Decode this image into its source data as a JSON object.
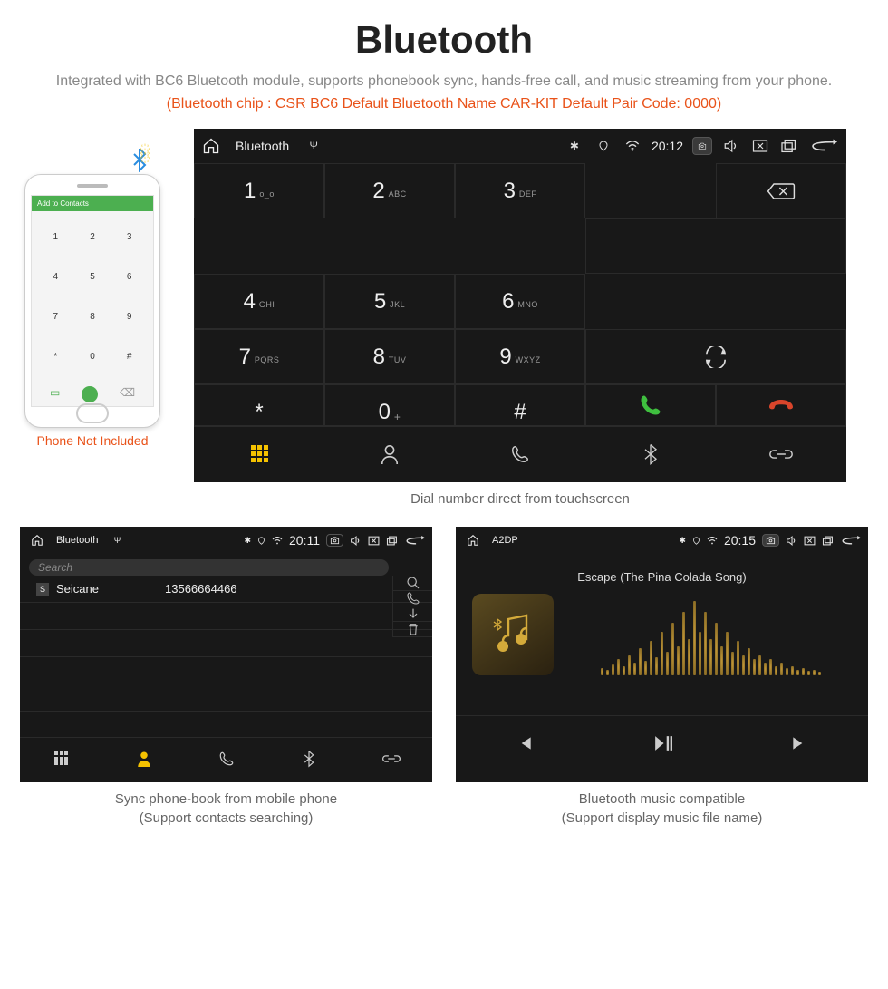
{
  "header": {
    "title": "Bluetooth",
    "subtitle": "Integrated with BC6 Bluetooth module, supports phonebook sync, hands-free call, and music streaming from your phone.",
    "specs": "(Bluetooth chip : CSR BC6    Default Bluetooth Name CAR-KIT    Default Pair Code: 0000)"
  },
  "phone_mock": {
    "top_label": "Add to Contacts",
    "digits": [
      "1",
      "2",
      "3",
      "4",
      "5",
      "6",
      "7",
      "8",
      "9",
      "*",
      "0",
      "#"
    ],
    "note": "Phone Not Included"
  },
  "hu_dialer": {
    "statusbar": {
      "title": "Bluetooth",
      "time": "20:12"
    },
    "keys": [
      {
        "d": "1",
        "s": "o_o"
      },
      {
        "d": "2",
        "s": "ABC"
      },
      {
        "d": "3",
        "s": "DEF"
      },
      {
        "d": "4",
        "s": "GHI"
      },
      {
        "d": "5",
        "s": "JKL"
      },
      {
        "d": "6",
        "s": "MNO"
      },
      {
        "d": "7",
        "s": "PQRS"
      },
      {
        "d": "8",
        "s": "TUV"
      },
      {
        "d": "9",
        "s": "WXYZ"
      },
      {
        "d": "*",
        "s": ""
      },
      {
        "d": "0",
        "s": "+"
      },
      {
        "d": "#",
        "s": ""
      }
    ],
    "caption": "Dial number direct from touchscreen"
  },
  "hu_phonebook": {
    "statusbar": {
      "title": "Bluetooth",
      "time": "20:11"
    },
    "search_placeholder": "Search",
    "rows": [
      {
        "badge": "S",
        "name": "Seicane",
        "number": "13566664466"
      }
    ],
    "caption_line1": "Sync phone-book from mobile phone",
    "caption_line2": "(Support contacts searching)"
  },
  "hu_music": {
    "statusbar": {
      "title": "A2DP",
      "time": "20:15"
    },
    "song": "Escape (The Pina Colada Song)",
    "caption_line1": "Bluetooth music compatible",
    "caption_line2": "(Support display music file name)"
  }
}
